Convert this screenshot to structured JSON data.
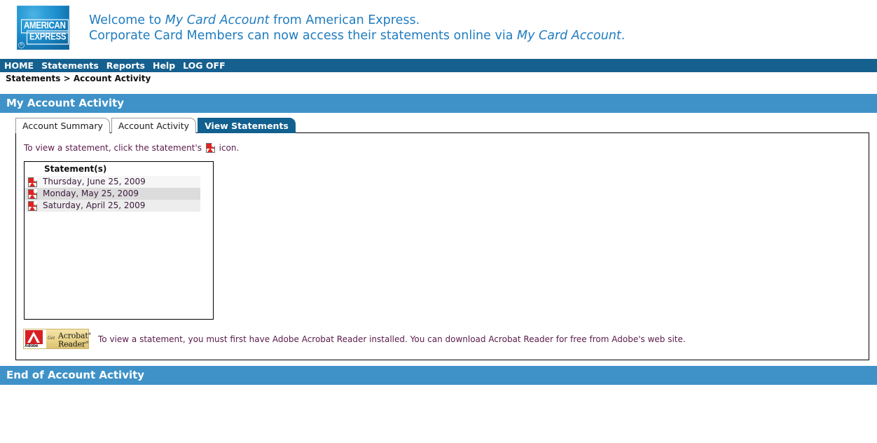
{
  "masthead": {
    "logo_line1": "AMERICAN",
    "logo_line2": "EXPRESS",
    "logo_registered": "®",
    "welcome_line1_a": "Welcome to ",
    "welcome_line1_em": "My Card Account",
    "welcome_line1_b": " from American Express.",
    "welcome_line2_a": "Corporate Card Members can now access their statements online via ",
    "welcome_line2_em": "My Card Account",
    "welcome_line2_b": "."
  },
  "nav": {
    "items": [
      {
        "label": "HOME"
      },
      {
        "label": "Statements"
      },
      {
        "label": "Reports"
      },
      {
        "label": "Help"
      },
      {
        "label": "LOG OFF"
      }
    ]
  },
  "breadcrumb": {
    "text": "Statements > Account Activity"
  },
  "page": {
    "title": "My Account Activity",
    "footer": "End of Account Activity"
  },
  "tabs": [
    {
      "label": "Account Summary",
      "active": false
    },
    {
      "label": "Account Activity",
      "active": false
    },
    {
      "label": "View Statements",
      "active": true
    }
  ],
  "content": {
    "instruction_before": "To view a statement, click the statement's",
    "instruction_after": "icon.",
    "statements_header": "Statement(s)",
    "statements": [
      {
        "date": "Thursday, June 25, 2009"
      },
      {
        "date": "Monday, May 25, 2009"
      },
      {
        "date": "Saturday, April 25, 2009"
      }
    ],
    "acrobat_badge": {
      "brand": "Adobe",
      "get": "Get",
      "word1": "Acrobat",
      "word2": "Reader",
      "registered": "®"
    },
    "acrobat_note": "To view a statement, you must first have Adobe Acrobat Reader installed. You can download Acrobat Reader for free from Adobe's web site."
  },
  "colors": {
    "nav_bar": "#15608f",
    "title_band": "#3e92c8",
    "active_tab": "#11608f",
    "link_text": "#1f7cc0",
    "body_text": "#5a1a4a",
    "pdf_red": "#e2211c"
  }
}
